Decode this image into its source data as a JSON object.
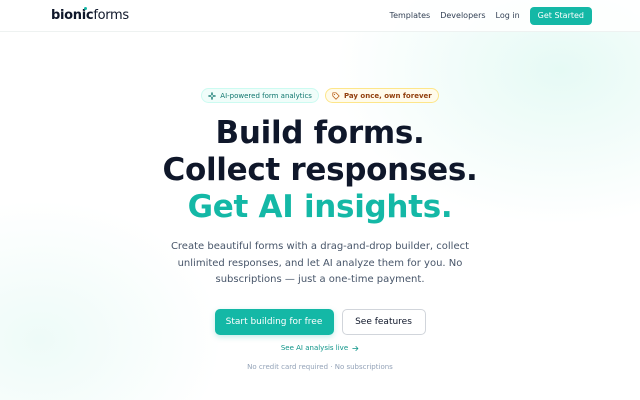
{
  "brand": {
    "name_bold": "bionic",
    "name_rest": "forms"
  },
  "nav": {
    "links": [
      "Templates",
      "Developers",
      "Log in"
    ],
    "cta": "Get Started"
  },
  "badges": {
    "ai": {
      "label": "AI-powered form analytics",
      "icon": "sparkle-icon"
    },
    "pay": {
      "label": "Pay once, own forever",
      "icon": "tag-icon"
    }
  },
  "headline": {
    "line1": "Build forms.",
    "line2": "Collect responses.",
    "line3": "Get AI insights."
  },
  "subheadline": "Create beautiful forms with a drag-and-drop builder, collect unlimited responses, and let AI analyze them for you. No subscriptions — just a one-time payment.",
  "ctas": {
    "primary": "Start building for free",
    "secondary": "See features"
  },
  "live_link": {
    "label": "See AI analysis live",
    "icon": "arrow-right-icon"
  },
  "fineprint": "No credit card required · No subscriptions",
  "colors": {
    "accent": "#14b8a6",
    "text": "#0f172a",
    "muted": "#475569"
  }
}
